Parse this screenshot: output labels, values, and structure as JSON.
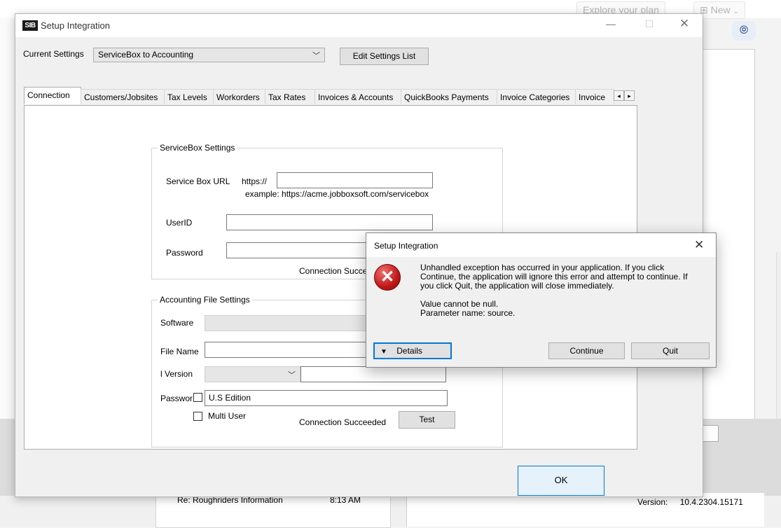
{
  "background": {
    "explore_label": "Explore your plan",
    "new_label": "New",
    "version_label": "Version:",
    "version_value": "10.4.2304.15171",
    "list_row_subject": "Re: Roughriders Information",
    "list_row_time": "8:13 AM"
  },
  "window": {
    "title": "Setup Integration",
    "logo_text": "SIB",
    "current_settings_label": "Current Settings",
    "current_settings_value": "ServiceBox to Accounting",
    "edit_settings_button": "Edit Settings List",
    "ok_button": "OK"
  },
  "tabs": [
    {
      "label": "Connection"
    },
    {
      "label": "Customers/Jobsites"
    },
    {
      "label": "Tax Levels"
    },
    {
      "label": "Workorders"
    },
    {
      "label": "Tax Rates"
    },
    {
      "label": "Invoices & Accounts"
    },
    {
      "label": "QuickBooks Payments"
    },
    {
      "label": "Invoice Categories"
    },
    {
      "label": "Invoice"
    }
  ],
  "servicebox": {
    "group_title": "ServiceBox Settings",
    "url_label": "Service Box URL",
    "url_prefix": "https://",
    "url_value": "",
    "url_example": "example: https://acme.jobboxsoft.com/servicebox",
    "userid_label": "UserID",
    "userid_value": "",
    "password_label": "Password",
    "password_value": "",
    "status": "Connection Succe"
  },
  "accounting": {
    "group_title": "Accounting File Settings",
    "software_label": "Software",
    "software_value": "",
    "filename_label": "File Name",
    "filename_value": "",
    "version_label": "l Version",
    "version_value": "",
    "password_label": "Passwor",
    "edition_value": "U.S Edition",
    "multiuser_label": "Multi User",
    "status": "Connection Succeeded",
    "test_button": "Test"
  },
  "dialog": {
    "title": "Setup Integration",
    "message": "Unhandled exception has occurred in your application. If you click Continue, the application will ignore this error and attempt to continue. If you click Quit, the application will close immediately.",
    "error_line1": "Value cannot be null.",
    "error_line2": "Parameter name: source.",
    "details_button": "Details",
    "continue_button": "Continue",
    "quit_button": "Quit"
  }
}
